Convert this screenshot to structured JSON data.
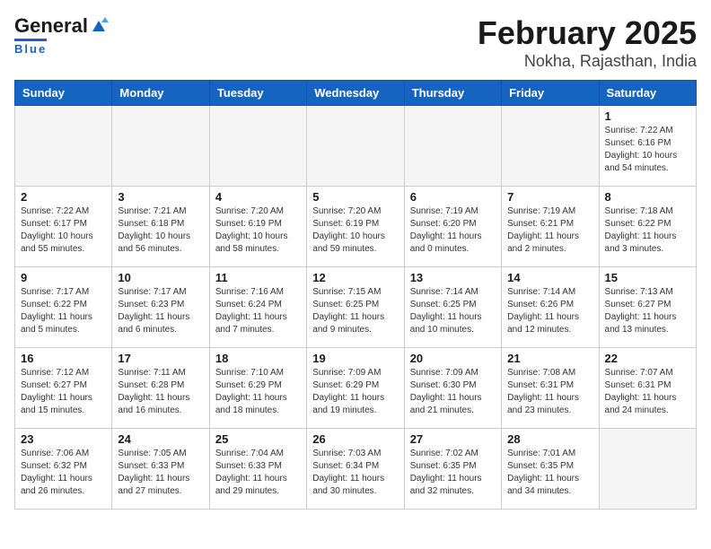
{
  "header": {
    "logo_general": "General",
    "logo_blue": "Blue",
    "title": "February 2025",
    "subtitle": "Nokha, Rajasthan, India"
  },
  "days_of_week": [
    "Sunday",
    "Monday",
    "Tuesday",
    "Wednesday",
    "Thursday",
    "Friday",
    "Saturday"
  ],
  "weeks": [
    [
      {
        "num": "",
        "info": ""
      },
      {
        "num": "",
        "info": ""
      },
      {
        "num": "",
        "info": ""
      },
      {
        "num": "",
        "info": ""
      },
      {
        "num": "",
        "info": ""
      },
      {
        "num": "",
        "info": ""
      },
      {
        "num": "1",
        "info": "Sunrise: 7:22 AM\nSunset: 6:16 PM\nDaylight: 10 hours and 54 minutes."
      }
    ],
    [
      {
        "num": "2",
        "info": "Sunrise: 7:22 AM\nSunset: 6:17 PM\nDaylight: 10 hours and 55 minutes."
      },
      {
        "num": "3",
        "info": "Sunrise: 7:21 AM\nSunset: 6:18 PM\nDaylight: 10 hours and 56 minutes."
      },
      {
        "num": "4",
        "info": "Sunrise: 7:20 AM\nSunset: 6:19 PM\nDaylight: 10 hours and 58 minutes."
      },
      {
        "num": "5",
        "info": "Sunrise: 7:20 AM\nSunset: 6:19 PM\nDaylight: 10 hours and 59 minutes."
      },
      {
        "num": "6",
        "info": "Sunrise: 7:19 AM\nSunset: 6:20 PM\nDaylight: 11 hours and 0 minutes."
      },
      {
        "num": "7",
        "info": "Sunrise: 7:19 AM\nSunset: 6:21 PM\nDaylight: 11 hours and 2 minutes."
      },
      {
        "num": "8",
        "info": "Sunrise: 7:18 AM\nSunset: 6:22 PM\nDaylight: 11 hours and 3 minutes."
      }
    ],
    [
      {
        "num": "9",
        "info": "Sunrise: 7:17 AM\nSunset: 6:22 PM\nDaylight: 11 hours and 5 minutes."
      },
      {
        "num": "10",
        "info": "Sunrise: 7:17 AM\nSunset: 6:23 PM\nDaylight: 11 hours and 6 minutes."
      },
      {
        "num": "11",
        "info": "Sunrise: 7:16 AM\nSunset: 6:24 PM\nDaylight: 11 hours and 7 minutes."
      },
      {
        "num": "12",
        "info": "Sunrise: 7:15 AM\nSunset: 6:25 PM\nDaylight: 11 hours and 9 minutes."
      },
      {
        "num": "13",
        "info": "Sunrise: 7:14 AM\nSunset: 6:25 PM\nDaylight: 11 hours and 10 minutes."
      },
      {
        "num": "14",
        "info": "Sunrise: 7:14 AM\nSunset: 6:26 PM\nDaylight: 11 hours and 12 minutes."
      },
      {
        "num": "15",
        "info": "Sunrise: 7:13 AM\nSunset: 6:27 PM\nDaylight: 11 hours and 13 minutes."
      }
    ],
    [
      {
        "num": "16",
        "info": "Sunrise: 7:12 AM\nSunset: 6:27 PM\nDaylight: 11 hours and 15 minutes."
      },
      {
        "num": "17",
        "info": "Sunrise: 7:11 AM\nSunset: 6:28 PM\nDaylight: 11 hours and 16 minutes."
      },
      {
        "num": "18",
        "info": "Sunrise: 7:10 AM\nSunset: 6:29 PM\nDaylight: 11 hours and 18 minutes."
      },
      {
        "num": "19",
        "info": "Sunrise: 7:09 AM\nSunset: 6:29 PM\nDaylight: 11 hours and 19 minutes."
      },
      {
        "num": "20",
        "info": "Sunrise: 7:09 AM\nSunset: 6:30 PM\nDaylight: 11 hours and 21 minutes."
      },
      {
        "num": "21",
        "info": "Sunrise: 7:08 AM\nSunset: 6:31 PM\nDaylight: 11 hours and 23 minutes."
      },
      {
        "num": "22",
        "info": "Sunrise: 7:07 AM\nSunset: 6:31 PM\nDaylight: 11 hours and 24 minutes."
      }
    ],
    [
      {
        "num": "23",
        "info": "Sunrise: 7:06 AM\nSunset: 6:32 PM\nDaylight: 11 hours and 26 minutes."
      },
      {
        "num": "24",
        "info": "Sunrise: 7:05 AM\nSunset: 6:33 PM\nDaylight: 11 hours and 27 minutes."
      },
      {
        "num": "25",
        "info": "Sunrise: 7:04 AM\nSunset: 6:33 PM\nDaylight: 11 hours and 29 minutes."
      },
      {
        "num": "26",
        "info": "Sunrise: 7:03 AM\nSunset: 6:34 PM\nDaylight: 11 hours and 30 minutes."
      },
      {
        "num": "27",
        "info": "Sunrise: 7:02 AM\nSunset: 6:35 PM\nDaylight: 11 hours and 32 minutes."
      },
      {
        "num": "28",
        "info": "Sunrise: 7:01 AM\nSunset: 6:35 PM\nDaylight: 11 hours and 34 minutes."
      },
      {
        "num": "",
        "info": ""
      }
    ]
  ]
}
